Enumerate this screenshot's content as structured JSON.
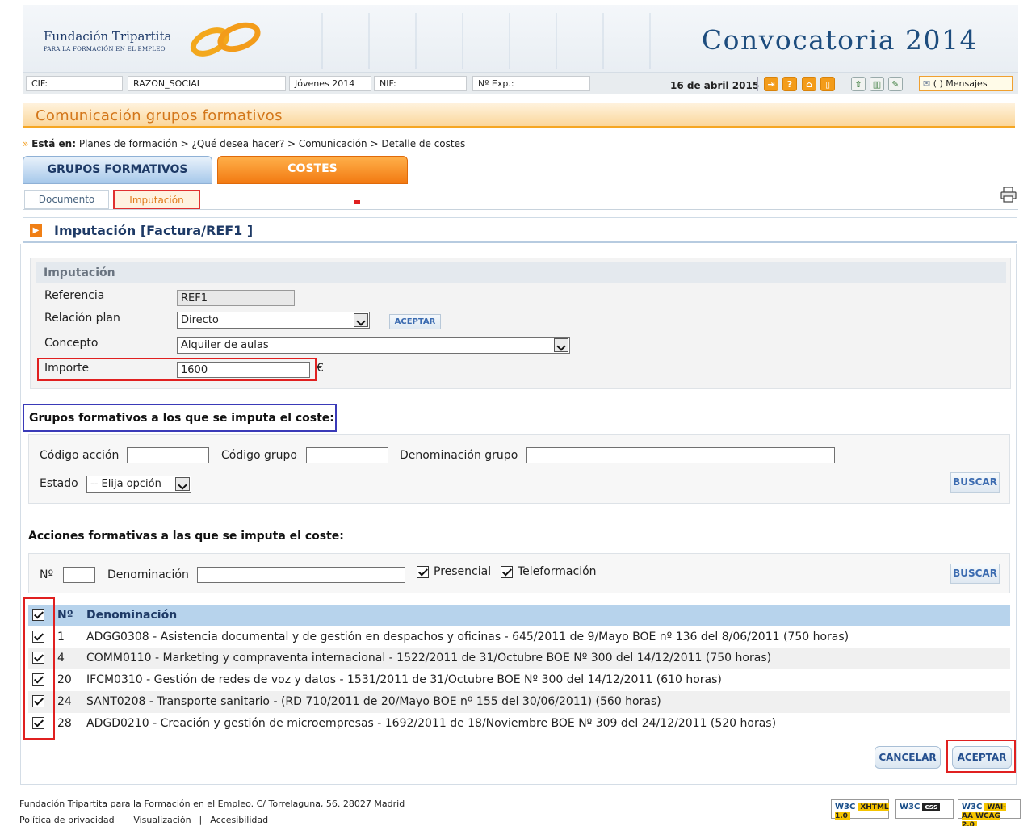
{
  "banner": {
    "org_name": "Fundación Tripartita",
    "org_sub": "PARA LA FORMACIÓN EN EL EMPLEO",
    "title": "Convocatoria 2014"
  },
  "infobar": {
    "cif": "CIF:",
    "razon_social": "RAZON_SOCIAL",
    "jovenes": "Jóvenes 2014",
    "nif": "NIF:",
    "nexp": "Nº Exp.:",
    "date": "16 de abril 2015",
    "mensajes": "(      ) Mensajes"
  },
  "section_title": "Comunicación grupos formativos",
  "breadcrumb": {
    "prefix": "Está en:",
    "path": "Planes de formación > ¿Qué desea hacer? > Comunicación > Detalle de costes"
  },
  "tabs": {
    "grupos": "GRUPOS FORMATIVOS",
    "costes": "COSTES",
    "documento": "Documento",
    "imputacion": "Imputación"
  },
  "imputacion_header": "Imputación [Factura/REF1 ]",
  "form": {
    "box_title": "Imputación",
    "referencia_label": "Referencia",
    "referencia_value": "REF1",
    "relacion_label": "Relación plan",
    "relacion_value": "Directo",
    "aceptar_small": "ACEPTAR",
    "concepto_label": "Concepto",
    "concepto_value": "Alquiler de aulas",
    "importe_label": "Importe",
    "importe_value": "1600",
    "currency": "€"
  },
  "grupos": {
    "title": "Grupos formativos a los que se imputa el coste:",
    "codigo_accion_label": "Código acción",
    "codigo_grupo_label": "Código grupo",
    "denominacion_grupo_label": "Denominación grupo",
    "estado_label": "Estado",
    "estado_value": "-- Elija opción",
    "buscar": "BUSCAR"
  },
  "acciones": {
    "title": "Acciones formativas a las que se imputa el coste:",
    "n_label": "Nº",
    "denominacion_label": "Denominación",
    "presencial_label": "Presencial",
    "teleformacion_label": "Teleformación",
    "buscar": "BUSCAR",
    "presencial_checked": true,
    "teleformacion_checked": true
  },
  "table": {
    "headers": [
      "Nº",
      "Denominación"
    ],
    "rows": [
      {
        "num": "1",
        "den": "ADGG0308 - Asistencia documental y de gestión en despachos y oficinas - 645/2011 de 9/Mayo BOE nº 136 del 8/06/2011 (750 horas)",
        "checked": true
      },
      {
        "num": "4",
        "den": "COMM0110 - Marketing y compraventa internacional - 1522/2011 de 31/Octubre BOE Nº 300 del 14/12/2011 (750 horas)",
        "checked": true
      },
      {
        "num": "20",
        "den": "IFCM0310 - Gestión de redes de voz y datos - 1531/2011 de 31/Octubre BOE Nº 300 del 14/12/2011 (610 horas)",
        "checked": true
      },
      {
        "num": "24",
        "den": "SANT0208 - Transporte sanitario - (RD 710/2011 de 20/Mayo BOE nº 155 del 30/06/2011) (560 horas)",
        "checked": true
      },
      {
        "num": "28",
        "den": "ADGD0210 - Creación y gestión de microempresas - 1692/2011 de 18/Noviembre BOE Nº 309 del 24/12/2011 (520 horas)",
        "checked": true
      }
    ]
  },
  "actions": {
    "cancelar": "CANCELAR",
    "aceptar": "ACEPTAR"
  },
  "footer": {
    "address": "Fundación Tripartita para la Formación en el Empleo. C/ Torrelaguna, 56. 28027 Madrid",
    "privacy": "Política de privacidad",
    "visualizacion": "Visualización",
    "accesibilidad": "Accesibilidad",
    "badge_xhtml": "XHTML 1.0",
    "badge_css": "css",
    "badge_wai": "WAI-AA WCAG 2.0",
    "w3c": "W3C"
  },
  "colors": {
    "accent_orange": "#f27a12",
    "link_blue": "#1e3a66",
    "highlight_red": "#e02020",
    "highlight_blue": "#3a3ab8"
  }
}
